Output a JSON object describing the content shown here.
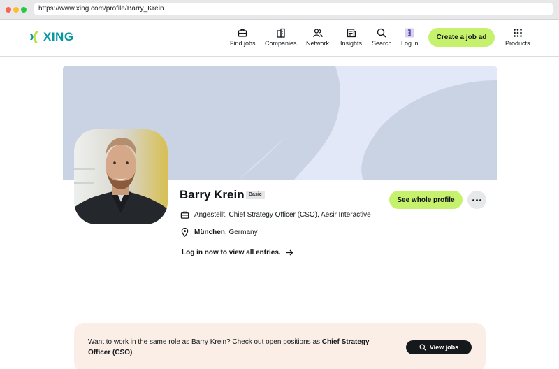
{
  "browser": {
    "url": "https://www.xing.com/profile/Barry_Krein"
  },
  "header": {
    "logo_text": "XING",
    "nav": [
      {
        "label": "Find jobs",
        "icon": "briefcase-icon"
      },
      {
        "label": "Companies",
        "icon": "building-icon"
      },
      {
        "label": "Network",
        "icon": "people-icon"
      },
      {
        "label": "Insights",
        "icon": "news-icon"
      },
      {
        "label": "Search",
        "icon": "search-icon"
      },
      {
        "label": "Log in",
        "icon": "login-icon"
      },
      {
        "label": "Products",
        "icon": "grid-icon"
      }
    ],
    "create_job_ad": "Create a job ad"
  },
  "profile": {
    "name": "Barry Krein",
    "badge": "Basic",
    "position": "Angestellt, Chief Strategy Officer (CSO), Aesir Interactive",
    "city": "München",
    "country": ", Germany",
    "login_link": "Log in now to view all entries.",
    "see_profile_button": "See whole profile"
  },
  "banner": {
    "text_prefix": "Want to work in the same role as Barry Krein? Check out open positions as ",
    "role": "Chief Strategy Officer (CSO)",
    "text_suffix": ".",
    "button": "View jobs"
  },
  "colors": {
    "accent": "#c6f16d",
    "brand": "#0698a0",
    "cover": "#c9d3e4",
    "banner": "#faeee6"
  }
}
